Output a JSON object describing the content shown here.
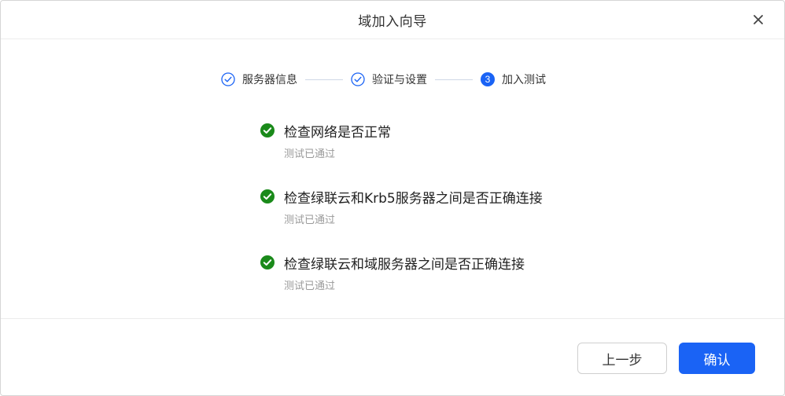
{
  "dialog": {
    "title": "域加入向导",
    "close_icon": "close-icon"
  },
  "stepper": {
    "steps": [
      {
        "label": "服务器信息",
        "state": "done",
        "icon": "check-circle-icon"
      },
      {
        "label": "验证与设置",
        "state": "done",
        "icon": "check-circle-icon"
      },
      {
        "label": "加入测试",
        "state": "active",
        "number": "3"
      }
    ],
    "accent_color": "#1a63f5"
  },
  "checks": {
    "items": [
      {
        "title": "检查网络是否正常",
        "status": "测试已通过"
      },
      {
        "title": "检查绿联云和Krb5服务器之间是否正确连接",
        "status": "测试已通过"
      },
      {
        "title": "检查绿联云和域服务器之间是否正确连接",
        "status": "测试已通过"
      }
    ],
    "success_color": "#1a8a1a"
  },
  "footer": {
    "back_label": "上一步",
    "confirm_label": "确认"
  }
}
